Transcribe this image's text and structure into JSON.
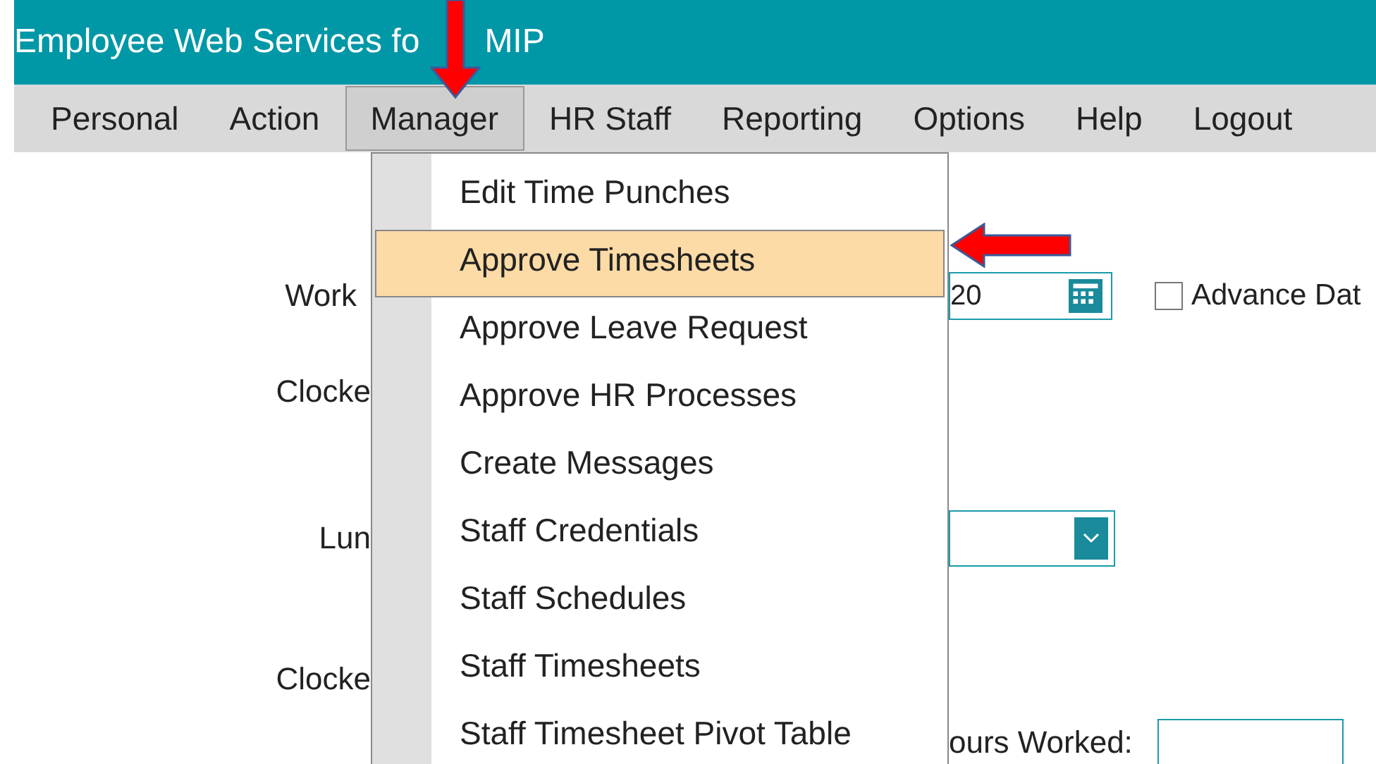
{
  "header": {
    "title_parts": [
      "Employee Web Services fo",
      "MIP"
    ]
  },
  "menubar": [
    {
      "label": "Personal",
      "selected": false
    },
    {
      "label": "Action",
      "selected": false
    },
    {
      "label": "Manager",
      "selected": true
    },
    {
      "label": "HR Staff",
      "selected": false
    },
    {
      "label": "Reporting",
      "selected": false
    },
    {
      "label": "Options",
      "selected": false
    },
    {
      "label": "Help",
      "selected": false
    },
    {
      "label": "Logout",
      "selected": false
    }
  ],
  "dropdown": [
    {
      "label": "Edit Time Punches",
      "selected": false
    },
    {
      "label": "Approve Timesheets",
      "selected": true
    },
    {
      "label": "Approve Leave Request",
      "selected": false
    },
    {
      "label": "Approve HR Processes",
      "selected": false
    },
    {
      "label": "Create Messages",
      "selected": false
    },
    {
      "label": "Staff Credentials",
      "selected": false
    },
    {
      "label": "Staff Schedules",
      "selected": false
    },
    {
      "label": "Staff Timesheets",
      "selected": false
    },
    {
      "label": "Staff Timesheet Pivot Table",
      "selected": false
    }
  ],
  "form": {
    "rows": [
      {
        "kind": "date",
        "label": "Work",
        "value": "20",
        "checkbox": {
          "label": "Advance Dat",
          "checked": false
        }
      },
      {
        "kind": "plain",
        "label": "Clocke"
      },
      {
        "kind": "select",
        "label": "Lun"
      },
      {
        "kind": "plain",
        "label": "Clocke"
      },
      {
        "kind": "hours",
        "label": "ours Worked:"
      }
    ]
  }
}
